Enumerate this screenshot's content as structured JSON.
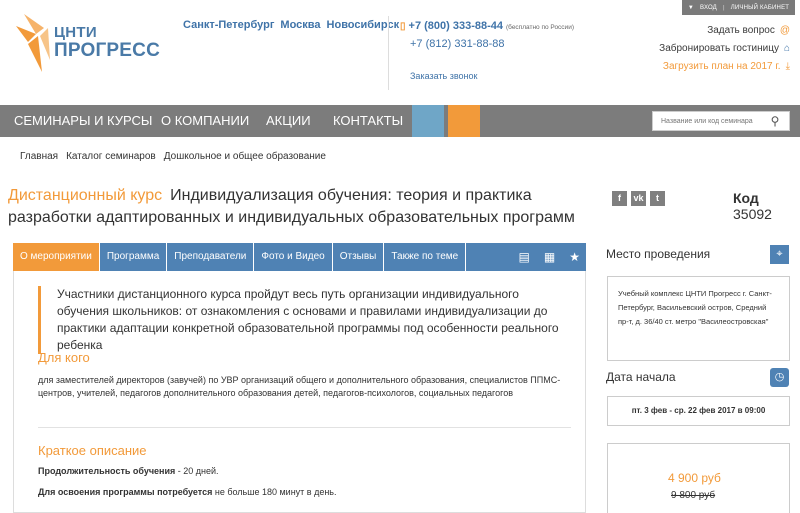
{
  "login_strip": {
    "enter": "ВХОД",
    "cabinet": "ЛИЧНЫЙ КАБИНЕТ"
  },
  "logo": {
    "line1": "ЦНТИ",
    "line2": "ПРОГРЕСС"
  },
  "cities": [
    "Санкт-Петербург",
    "Москва",
    "Новосибирск"
  ],
  "contacts": {
    "phone1": "+7 (800) 333-88-44",
    "phone1_note": "(бесплатно по России)",
    "phone2": "+7 (812) 331-88-88",
    "callback": "Заказать звонок"
  },
  "right_links": {
    "ask": "Задать вопрос",
    "hotel": "Забронировать гостиницу",
    "plan": "Загрузить план на 2017 г."
  },
  "nav": {
    "items": [
      "СЕМИНАРЫ И КУРСЫ",
      "О КОМПАНИИ",
      "АКЦИИ",
      "КОНТАКТЫ"
    ],
    "search_placeholder": "Название или код семинара"
  },
  "breadcrumb": [
    "Главная",
    "Каталог семинаров",
    "Дошкольное и общее образование"
  ],
  "page": {
    "kind": "Дистанционный курс",
    "title": "Индивидуализация обучения: теория и практика разработки адаптированных и индивидуальных образовательных программ",
    "code_label": "Код",
    "code_value": "35092"
  },
  "social": [
    "f",
    "vk",
    "t"
  ],
  "tabs": [
    "О мероприятии",
    "Программа",
    "Преподаватели",
    "Фото и Видео",
    "Отзывы",
    "Также по теме"
  ],
  "content": {
    "lead": "Участники дистанционного курса пройдут весь путь организации индивидуального обучения школьников: от ознакомления с основами и правилами индивидуализации до практики адаптации конкретной образовательной программы под особенности реального ребенка",
    "for_whom_title": "Для кого",
    "for_whom_text": "для заместителей директоров (завучей) по УВР организаций общего и дополнительного образования, специалистов ППМС-центров, учителей, педагогов дополнительного образования детей, педагогов-психологов, социальных педагогов",
    "short_title": "Краткое описание",
    "duration_label": "Продолжительность обучения",
    "duration_value": " - 20 дней.",
    "time_label": "Для освоения программы потребуется",
    "time_value": " не больше 180 минут в день."
  },
  "sidebar": {
    "venue_title": "Место проведения",
    "venue_text": "Учебный комплекс ЦНТИ Прогресс г. Санкт-Петербург, Васильевский остров, Средний пр-т, д. 36/40 ст. метро \"Василеостровская\"",
    "date_title": "Дата начала",
    "date_text": "пт. 3 фев - ср. 22 фев 2017 в 09:00",
    "price": "4 900 руб",
    "old_price": "9 800 руб"
  },
  "colors": {
    "accent": "#f29a3a",
    "brand_blue": "#4f82b4",
    "nav_gray": "#7c7c7c"
  }
}
